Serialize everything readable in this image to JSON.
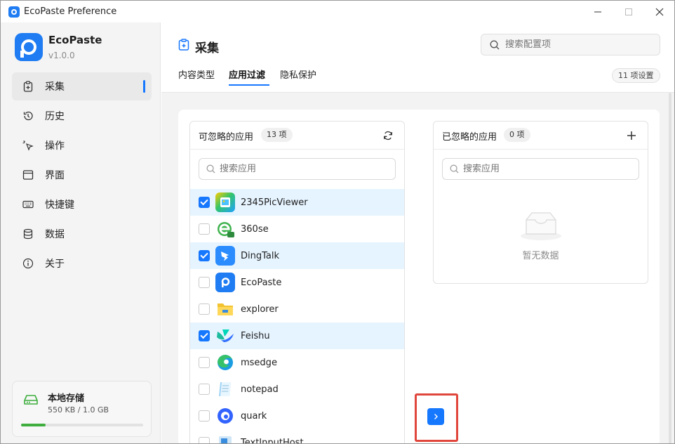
{
  "window": {
    "title": "EcoPaste Preference"
  },
  "sidebar": {
    "brand": "EcoPaste",
    "version": "v1.0.0",
    "items": [
      {
        "label": "采集",
        "icon": "clipboard-plus-icon",
        "active": true
      },
      {
        "label": "历史",
        "icon": "history-icon"
      },
      {
        "label": "操作",
        "icon": "cursor-click-icon"
      },
      {
        "label": "界面",
        "icon": "window-layout-icon"
      },
      {
        "label": "快捷键",
        "icon": "keyboard-icon"
      },
      {
        "label": "数据",
        "icon": "database-icon"
      },
      {
        "label": "关于",
        "icon": "info-icon"
      }
    ],
    "storage": {
      "title": "本地存储",
      "size": "550 KB / 1.0 GB",
      "used_fraction": 0.2,
      "color": "#3fae3f"
    }
  },
  "header": {
    "title": "采集",
    "search_placeholder": "搜索配置项",
    "tabs": [
      "内容类型",
      "应用过滤",
      "隐私保护"
    ],
    "active_tab": "应用过滤",
    "settings_count": "11 项设置"
  },
  "left_panel": {
    "title": "可忽略的应用",
    "count": "13 项",
    "search_placeholder": "搜索应用",
    "apps": [
      {
        "name": "2345PicViewer",
        "checked": true
      },
      {
        "name": "360se",
        "checked": false
      },
      {
        "name": "DingTalk",
        "checked": true
      },
      {
        "name": "EcoPaste",
        "checked": false
      },
      {
        "name": "explorer",
        "checked": false
      },
      {
        "name": "Feishu",
        "checked": true
      },
      {
        "name": "msedge",
        "checked": false
      },
      {
        "name": "notepad",
        "checked": false
      },
      {
        "name": "quark",
        "checked": false
      },
      {
        "name": "TextInputHost",
        "checked": false
      }
    ]
  },
  "right_panel": {
    "title": "已忽略的应用",
    "count": "0 项",
    "search_placeholder": "搜索应用",
    "empty_text": "暂无数据"
  },
  "colors": {
    "accent": "#1677ff",
    "highlight": "#e0463b",
    "selected_row": "#e6f4ff"
  }
}
